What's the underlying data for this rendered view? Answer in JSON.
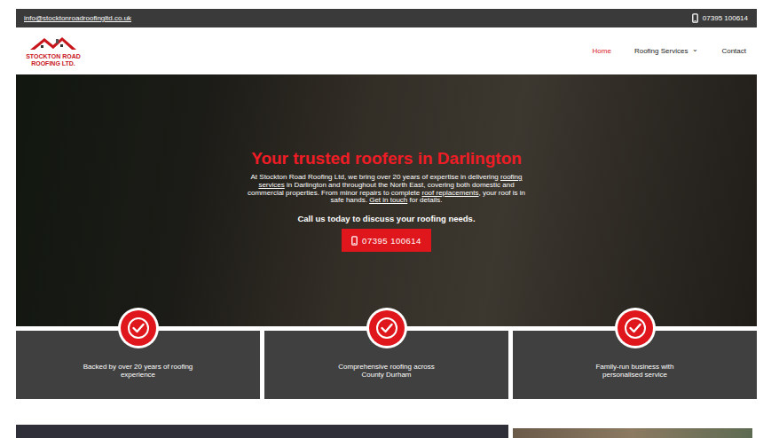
{
  "topbar": {
    "email": "info@stocktonroadroofingltd.co.uk",
    "phone": "07395 100614"
  },
  "logo": {
    "line1": "STOCKTON ROAD",
    "line2": "ROOFING LTD."
  },
  "nav": [
    {
      "label": "Home",
      "selected": true,
      "dropdown": ""
    },
    {
      "label": "Roofing Services",
      "selected": false,
      "dropdown": "⌄"
    },
    {
      "label": "Contact",
      "selected": false,
      "dropdown": ""
    }
  ],
  "hero": {
    "title": "Your trusted roofers in Darlington",
    "paragraph": [
      {
        "text": "At Stockton Road Roofing Ltd, we bring over 20 years of expertise in delivering ",
        "kind": "text"
      },
      {
        "text": "roofing services",
        "kind": "link"
      },
      {
        "text": " in Darlington and throughout the North East, covering both domestic and commercial properties. From minor repairs to complete ",
        "kind": "text"
      },
      {
        "text": "roof replacements",
        "kind": "link"
      },
      {
        "text": ", your roof is in safe hands. ",
        "kind": "text"
      },
      {
        "text": "Get in touch",
        "kind": "link"
      },
      {
        "text": " for details.",
        "kind": "text"
      }
    ],
    "call": "Call us today to discuss your roofing needs.",
    "button": "07395 100614"
  },
  "features": [
    "Backed by over 20 years of roofing experience",
    "Comprehensive roofing across County Durham",
    "Family-run business with personalised service"
  ]
}
